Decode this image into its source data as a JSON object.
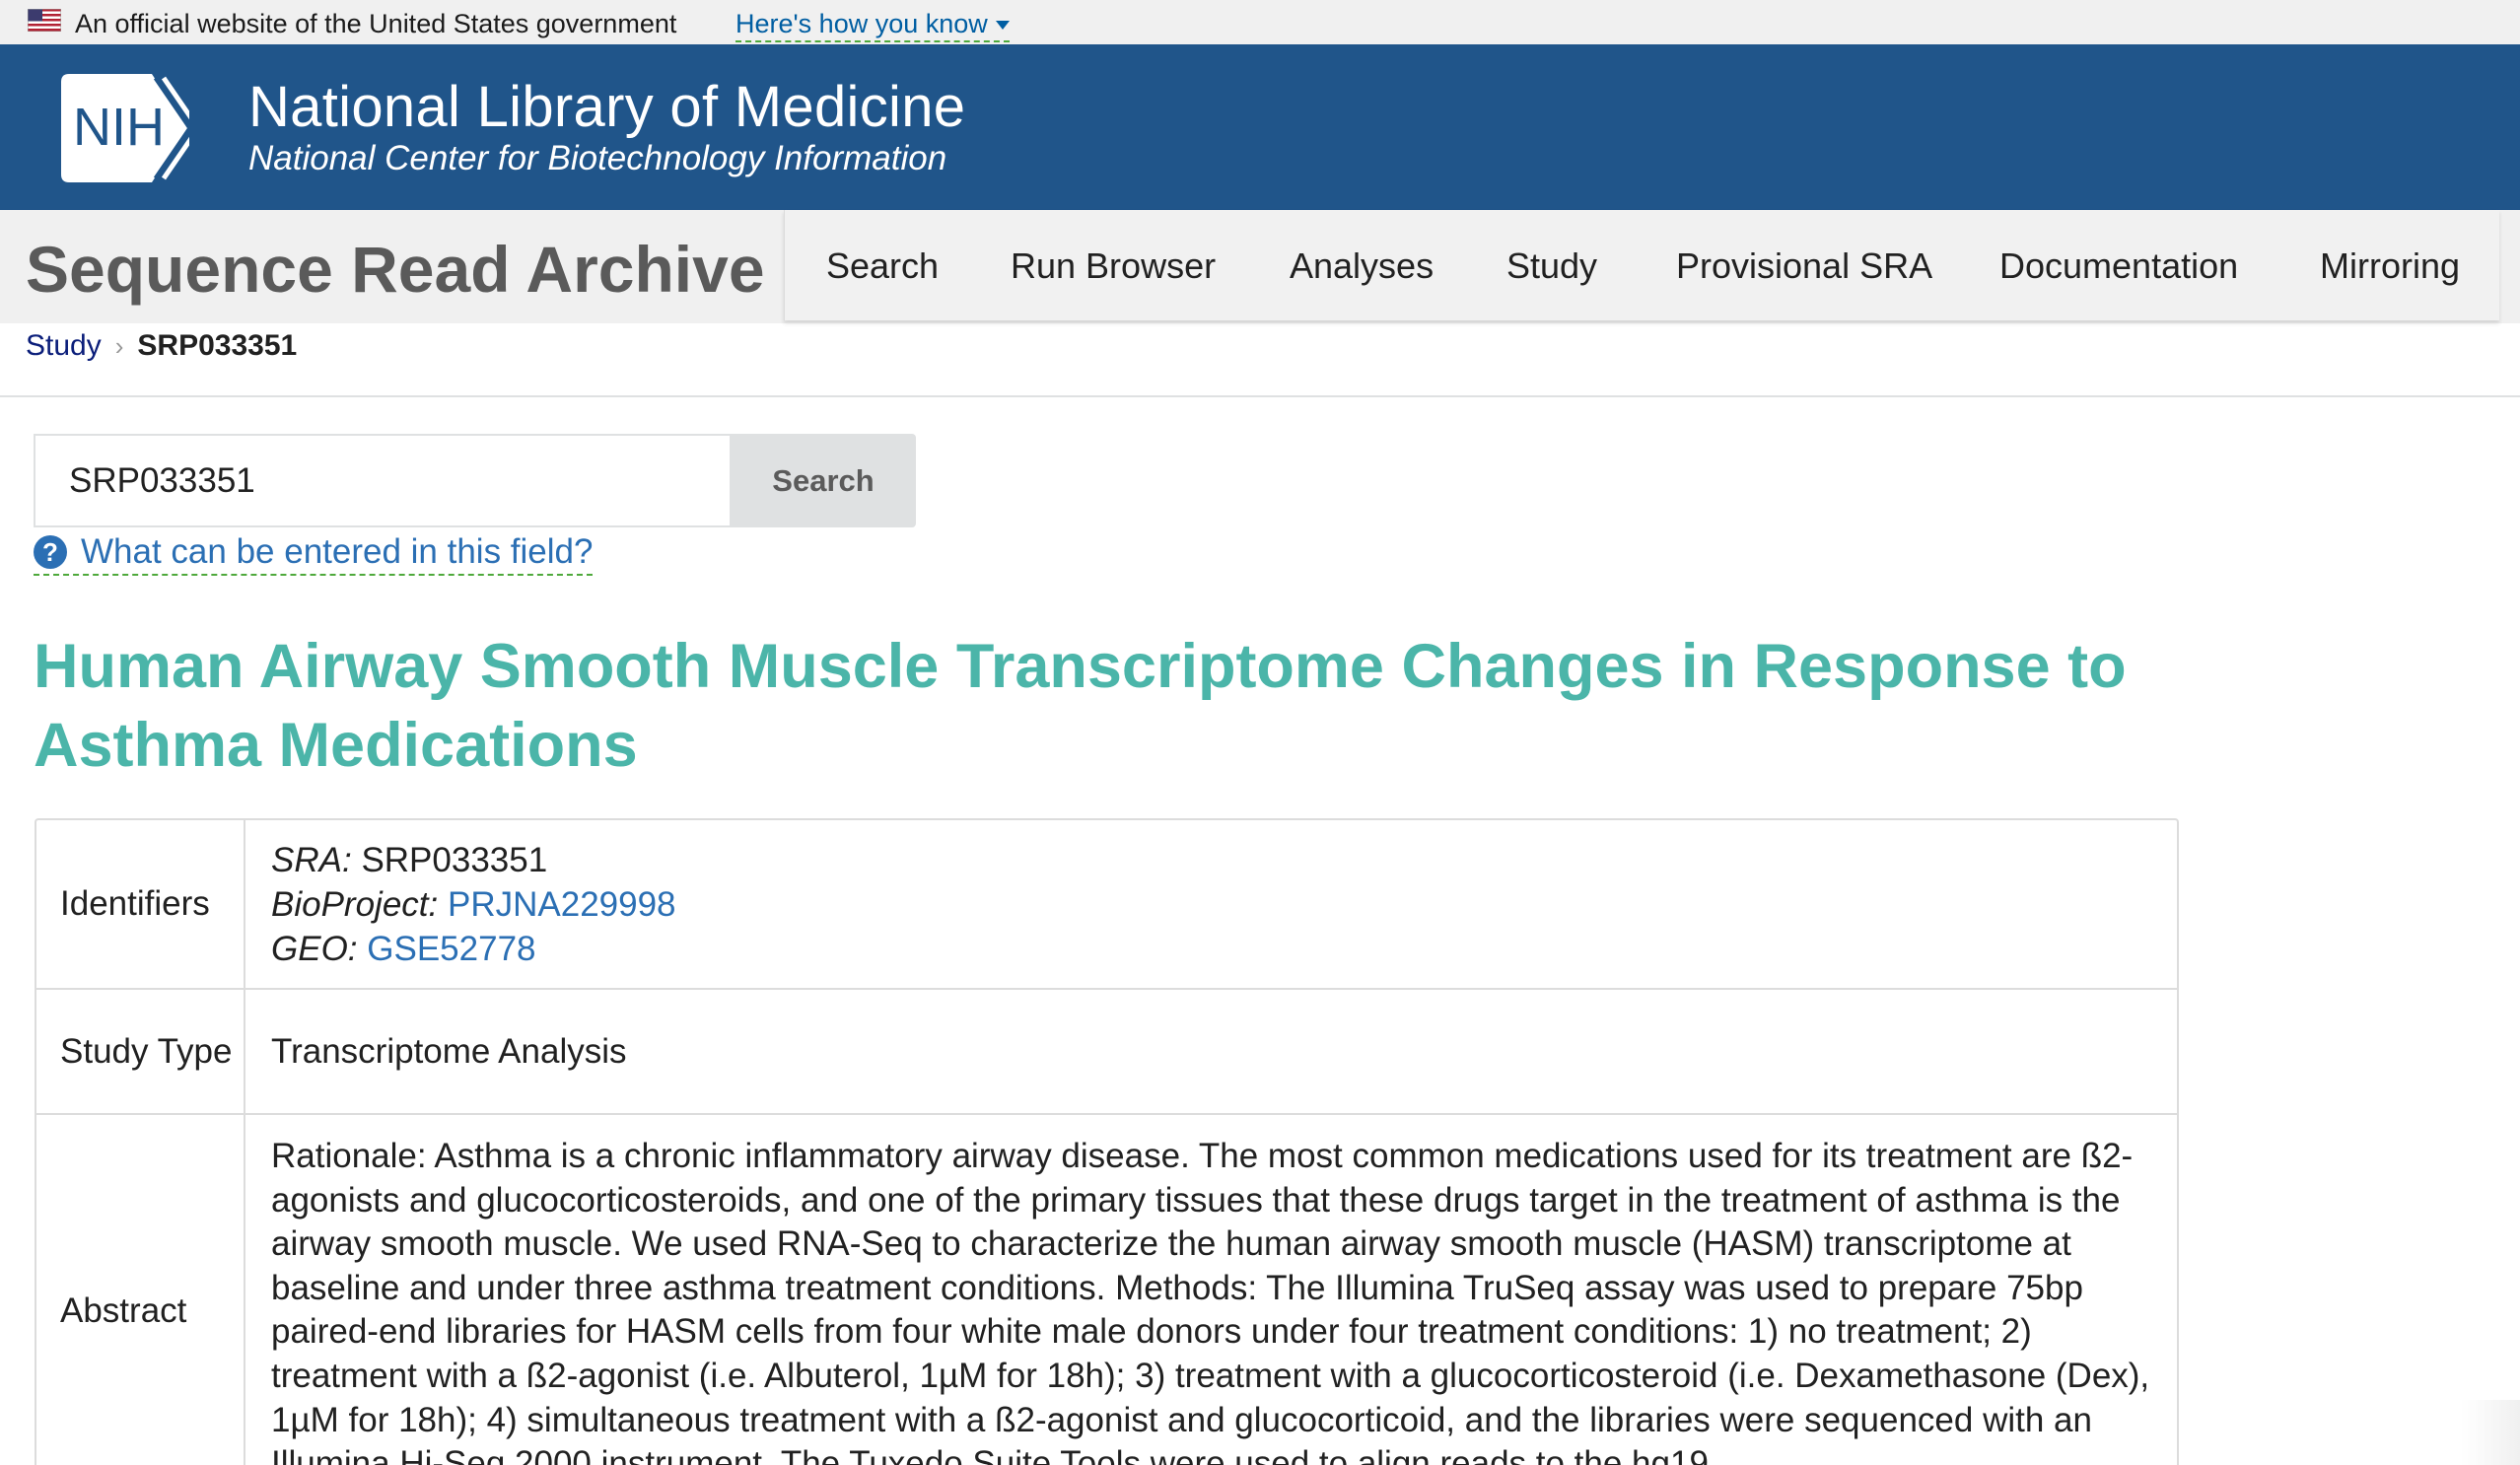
{
  "gov_banner": {
    "text": "An official website of the United States government",
    "link": "Here's how you know"
  },
  "nih_header": {
    "logo_text": "NIH",
    "title": "National Library of Medicine",
    "subtitle": "National Center for Biotechnology Information"
  },
  "sra_bar": {
    "title": "Sequence Read Archive",
    "nav": [
      "Search",
      "Run Browser",
      "Analyses",
      "Study",
      "Provisional SRA",
      "Documentation",
      "Mirroring"
    ]
  },
  "breadcrumb": {
    "parent": "Study",
    "current": "SRP033351"
  },
  "search": {
    "value": "SRP033351",
    "button": "Search",
    "help": "What can be entered in this field?"
  },
  "study": {
    "title": "Human Airway Smooth Muscle Transcriptome Changes in Response to Asthma Medications",
    "labels": {
      "identifiers": "Identifiers",
      "study_type": "Study Type",
      "abstract": "Abstract"
    },
    "identifiers": [
      {
        "key": "SRA:",
        "value": "SRP033351"
      },
      {
        "key": "BioProject:",
        "value": "PRJNA229998"
      },
      {
        "key": "GEO:",
        "value": "GSE52778"
      }
    ],
    "study_type": "Transcriptome Analysis",
    "abstract": "Rationale: Asthma is a chronic inflammatory airway disease. The most common medications used for its treatment are ß2-agonists and glucocorticosteroids, and one of the primary tissues that these drugs target in the treatment of asthma is the airway smooth muscle. We used RNA-Seq to characterize the human airway smooth muscle (HASM) transcriptome at baseline and under three asthma treatment conditions. Methods: The Illumina TruSeq assay was used to prepare 75bp paired-end libraries for HASM cells from four white male donors under four treatment conditions: 1) no treatment; 2) treatment with a ß2-agonist (i.e. Albuterol, 1µM for 18h); 3) treatment with a glucocorticosteroid (i.e. Dexamethasone (Dex), 1µM for 18h); 4) simultaneous treatment with a ß2-agonist and glucocorticoid, and the libraries were sequenced with an Illumina Hi-Seq 2000 instrument. The Tuxedo Suite Tools were used to align reads to the hg19"
  }
}
